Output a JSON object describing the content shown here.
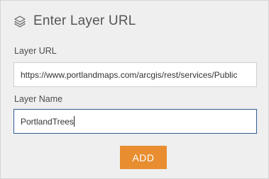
{
  "header": {
    "icon": "layers-icon",
    "title": "Enter Layer URL"
  },
  "layer_url": {
    "label": "Layer URL",
    "value": "https://www.portlandmaps.com/arcgis/rest/services/Public"
  },
  "layer_name": {
    "label": "Layer Name",
    "value": "PortlandTrees"
  },
  "add_button": {
    "label": "ADD",
    "color": "#e88e31"
  },
  "colors": {
    "panel_background": "#efefef",
    "active_border": "#2f5f91"
  }
}
